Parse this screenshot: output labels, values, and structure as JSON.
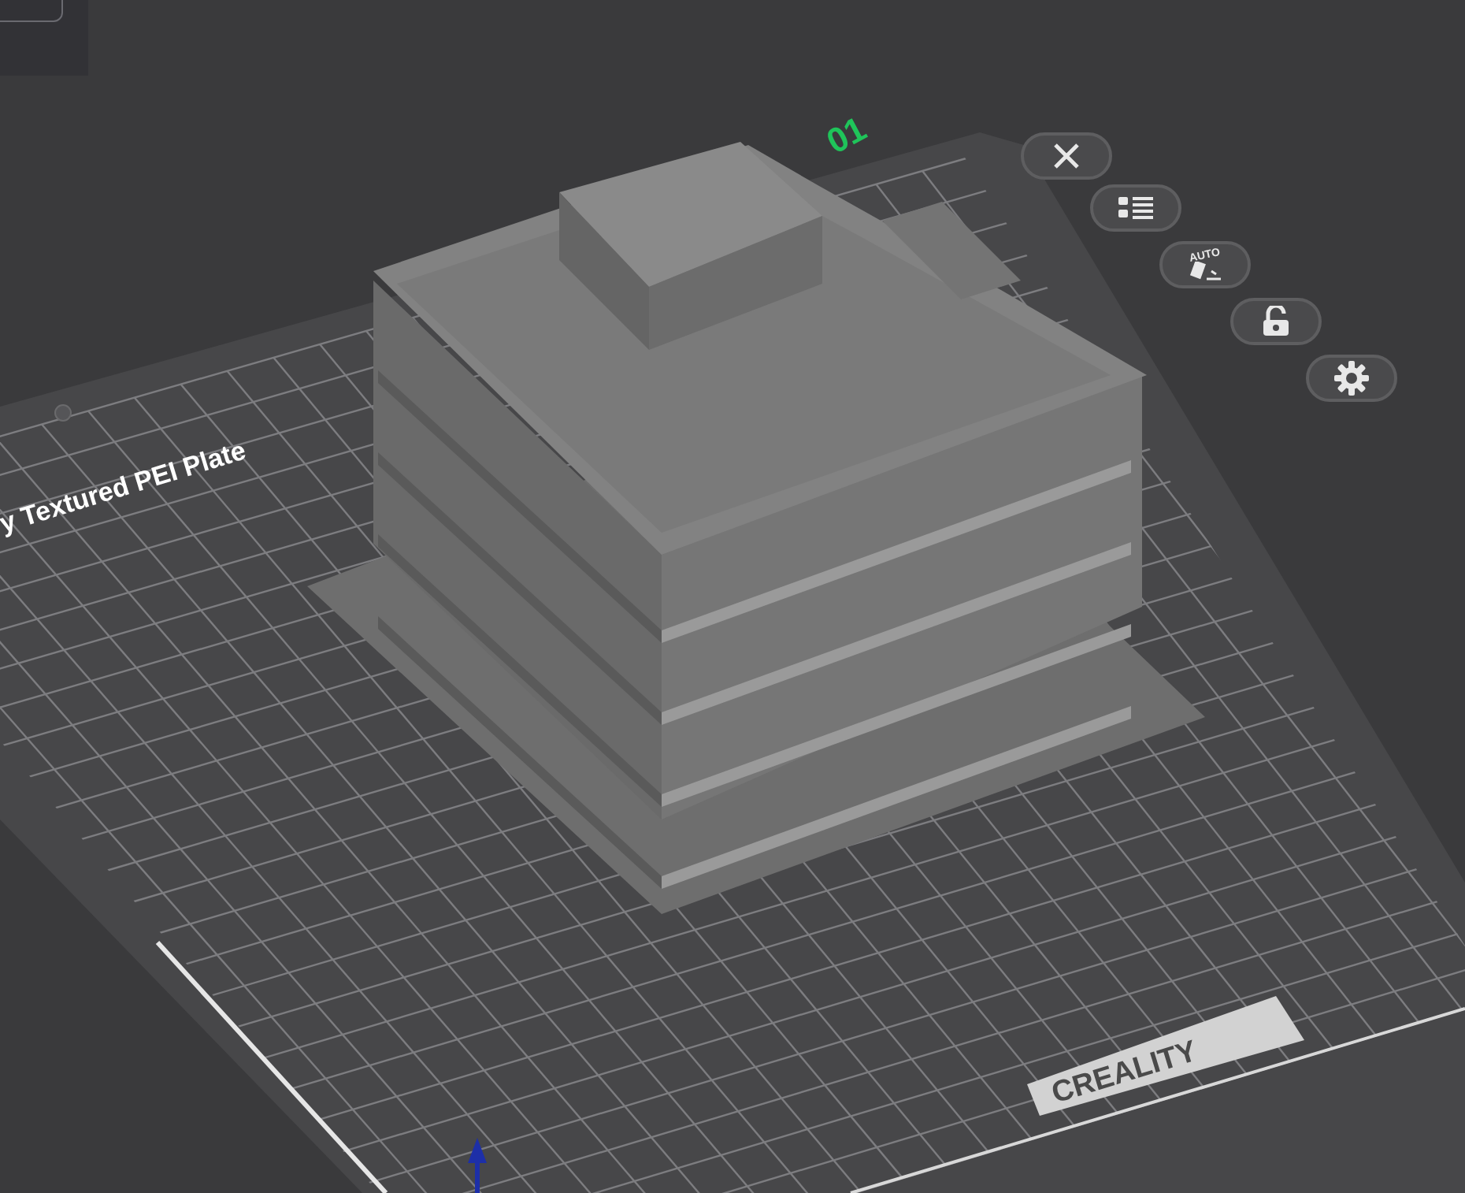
{
  "plate": {
    "number": "01",
    "label": "y Textured PEI Plate",
    "brand": "CREALITY"
  },
  "toolbar": [
    {
      "kind": "close"
    },
    {
      "kind": "list"
    },
    {
      "kind": "auto",
      "label": "AUTO"
    },
    {
      "kind": "lock"
    },
    {
      "kind": "settings"
    }
  ]
}
